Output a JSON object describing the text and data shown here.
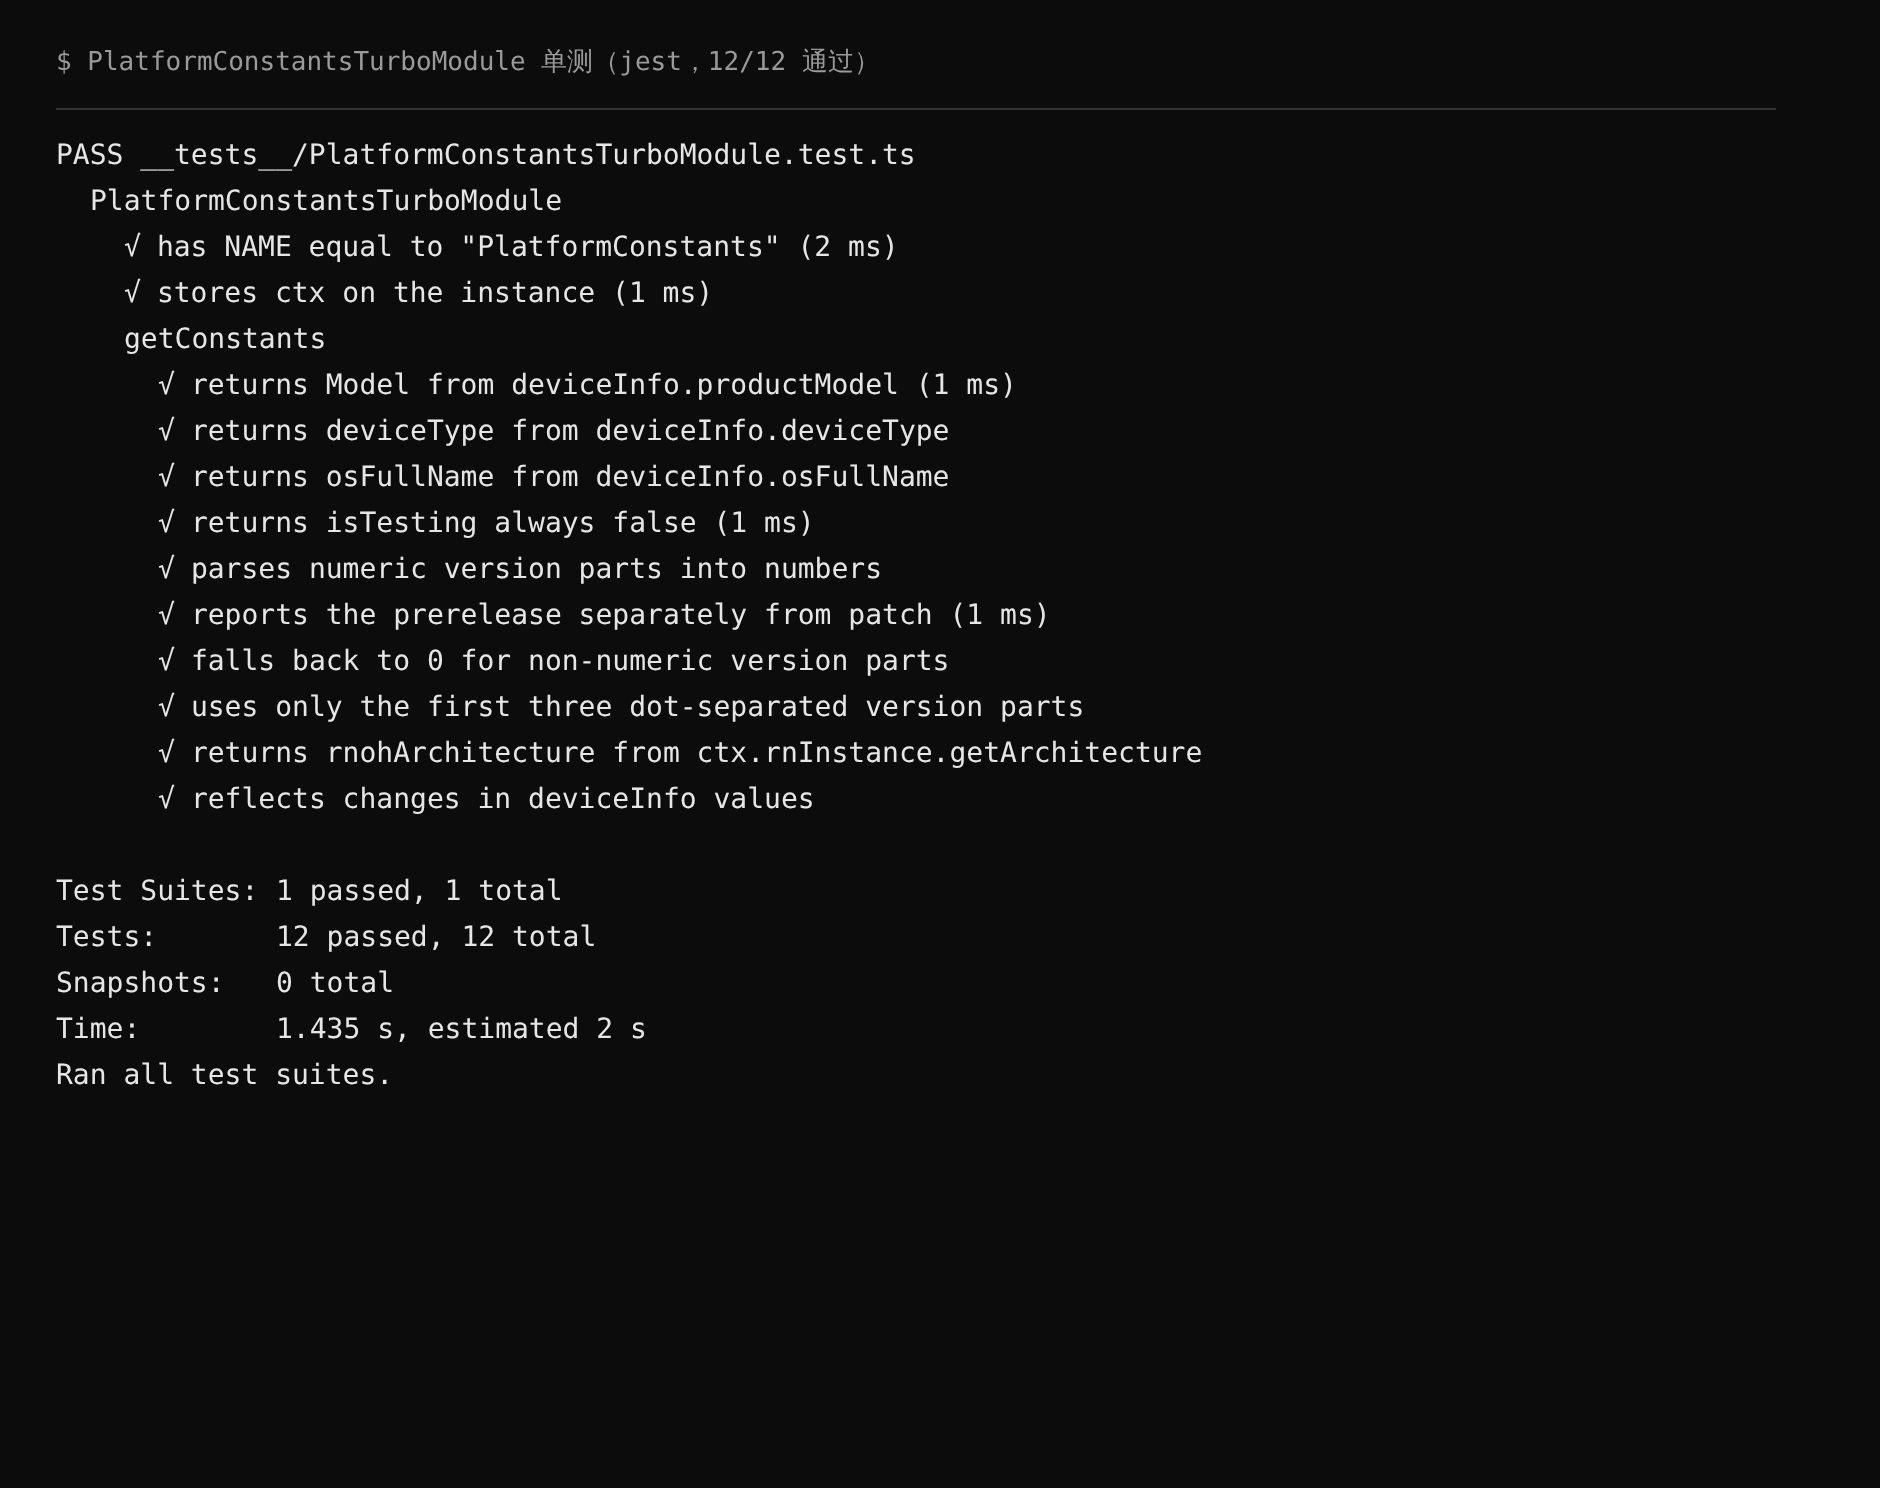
{
  "header": {
    "prompt": "$",
    "command": "PlatformConstantsTurboModule 单测（jest，12/12 通过）"
  },
  "result": {
    "status": "PASS",
    "file": "__tests__/PlatformConstantsTurboModule.test.ts"
  },
  "suites": [
    {
      "kind": "suite",
      "title": "PlatformConstantsTurboModule",
      "children": [
        {
          "kind": "test",
          "mark": "√",
          "name": "has NAME equal to \"PlatformConstants\" (2 ms)"
        },
        {
          "kind": "test",
          "mark": "√",
          "name": "stores ctx on the instance (1 ms)"
        },
        {
          "kind": "suite",
          "title": "getConstants",
          "children": [
            {
              "kind": "test",
              "mark": "√",
              "name": "returns Model from deviceInfo.productModel (1 ms)"
            },
            {
              "kind": "test",
              "mark": "√",
              "name": "returns deviceType from deviceInfo.deviceType"
            },
            {
              "kind": "test",
              "mark": "√",
              "name": "returns osFullName from deviceInfo.osFullName"
            },
            {
              "kind": "test",
              "mark": "√",
              "name": "returns isTesting always false (1 ms)"
            },
            {
              "kind": "test",
              "mark": "√",
              "name": "parses numeric version parts into numbers"
            },
            {
              "kind": "test",
              "mark": "√",
              "name": "reports the prerelease separately from patch (1 ms)"
            },
            {
              "kind": "test",
              "mark": "√",
              "name": "falls back to 0 for non-numeric version parts"
            },
            {
              "kind": "test",
              "mark": "√",
              "name": "uses only the first three dot-separated version parts"
            },
            {
              "kind": "test",
              "mark": "√",
              "name": "returns rnohArchitecture from ctx.rnInstance.getArchitecture"
            },
            {
              "kind": "test",
              "mark": "√",
              "name": "reflects changes in deviceInfo values"
            }
          ]
        }
      ]
    }
  ],
  "summary": [
    {
      "label": "Test Suites:",
      "value": "1 passed, 1 total"
    },
    {
      "label": "Tests:",
      "value": "12 passed, 12 total"
    },
    {
      "label": "Snapshots:",
      "value": "0 total"
    },
    {
      "label": "Time:",
      "value": "1.435 s, estimated 2 s"
    }
  ],
  "footer": "Ran all test suites."
}
